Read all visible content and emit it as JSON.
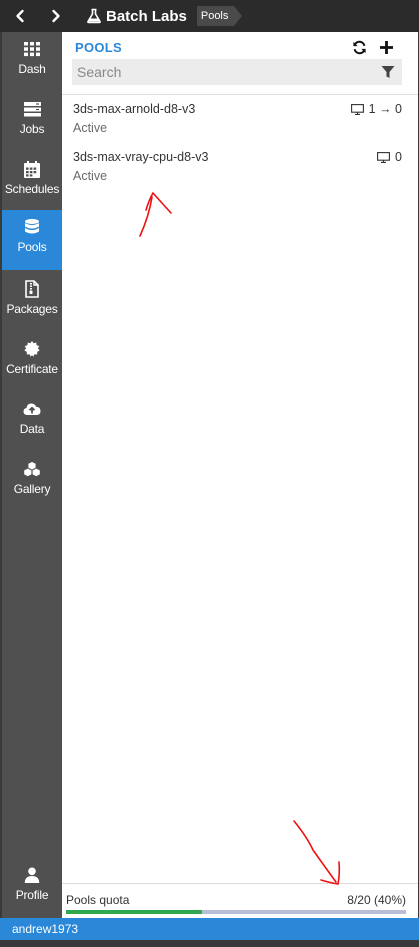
{
  "titlebar": {
    "back_icon": "chevron-left-icon",
    "forward_icon": "chevron-right-icon",
    "brand_icon": "flask-icon",
    "app_name": "Batch Labs",
    "breadcrumb": "Pools"
  },
  "sidebar": {
    "active_color": "#2b88d8",
    "items": [
      {
        "label": "Dash",
        "icon": "grid-icon"
      },
      {
        "label": "Jobs",
        "icon": "server-icon"
      },
      {
        "label": "Schedules",
        "icon": "calendar-icon"
      },
      {
        "label": "Pools",
        "icon": "database-icon",
        "active": true
      },
      {
        "label": "Packages",
        "icon": "file-archive-icon"
      },
      {
        "label": "Certificate",
        "icon": "certificate-icon"
      },
      {
        "label": "Data",
        "icon": "cloud-upload-icon"
      },
      {
        "label": "Gallery",
        "icon": "cubes-icon"
      }
    ],
    "profile": {
      "label": "Profile",
      "icon": "user-icon"
    }
  },
  "main": {
    "title": "POOLS",
    "refresh_icon": "refresh-icon",
    "add_icon": "plus-icon",
    "search": {
      "placeholder": "Search",
      "value": ""
    },
    "filter_icon": "filter-icon",
    "pools": [
      {
        "name": "3ds-max-arnold-d8-v3",
        "state": "Active",
        "nodes": "1 → 0"
      },
      {
        "name": "3ds-max-vray-cpu-d8-v3",
        "state": "Active",
        "nodes": "0"
      }
    ]
  },
  "quota": {
    "label": "Pools quota",
    "value": "8/20 (40%)",
    "fraction": 0.4,
    "fill_color": "#2fa84f",
    "track_color": "#b9bfd6"
  },
  "footer": {
    "user": "andrew1973",
    "color": "#2b88d8"
  }
}
